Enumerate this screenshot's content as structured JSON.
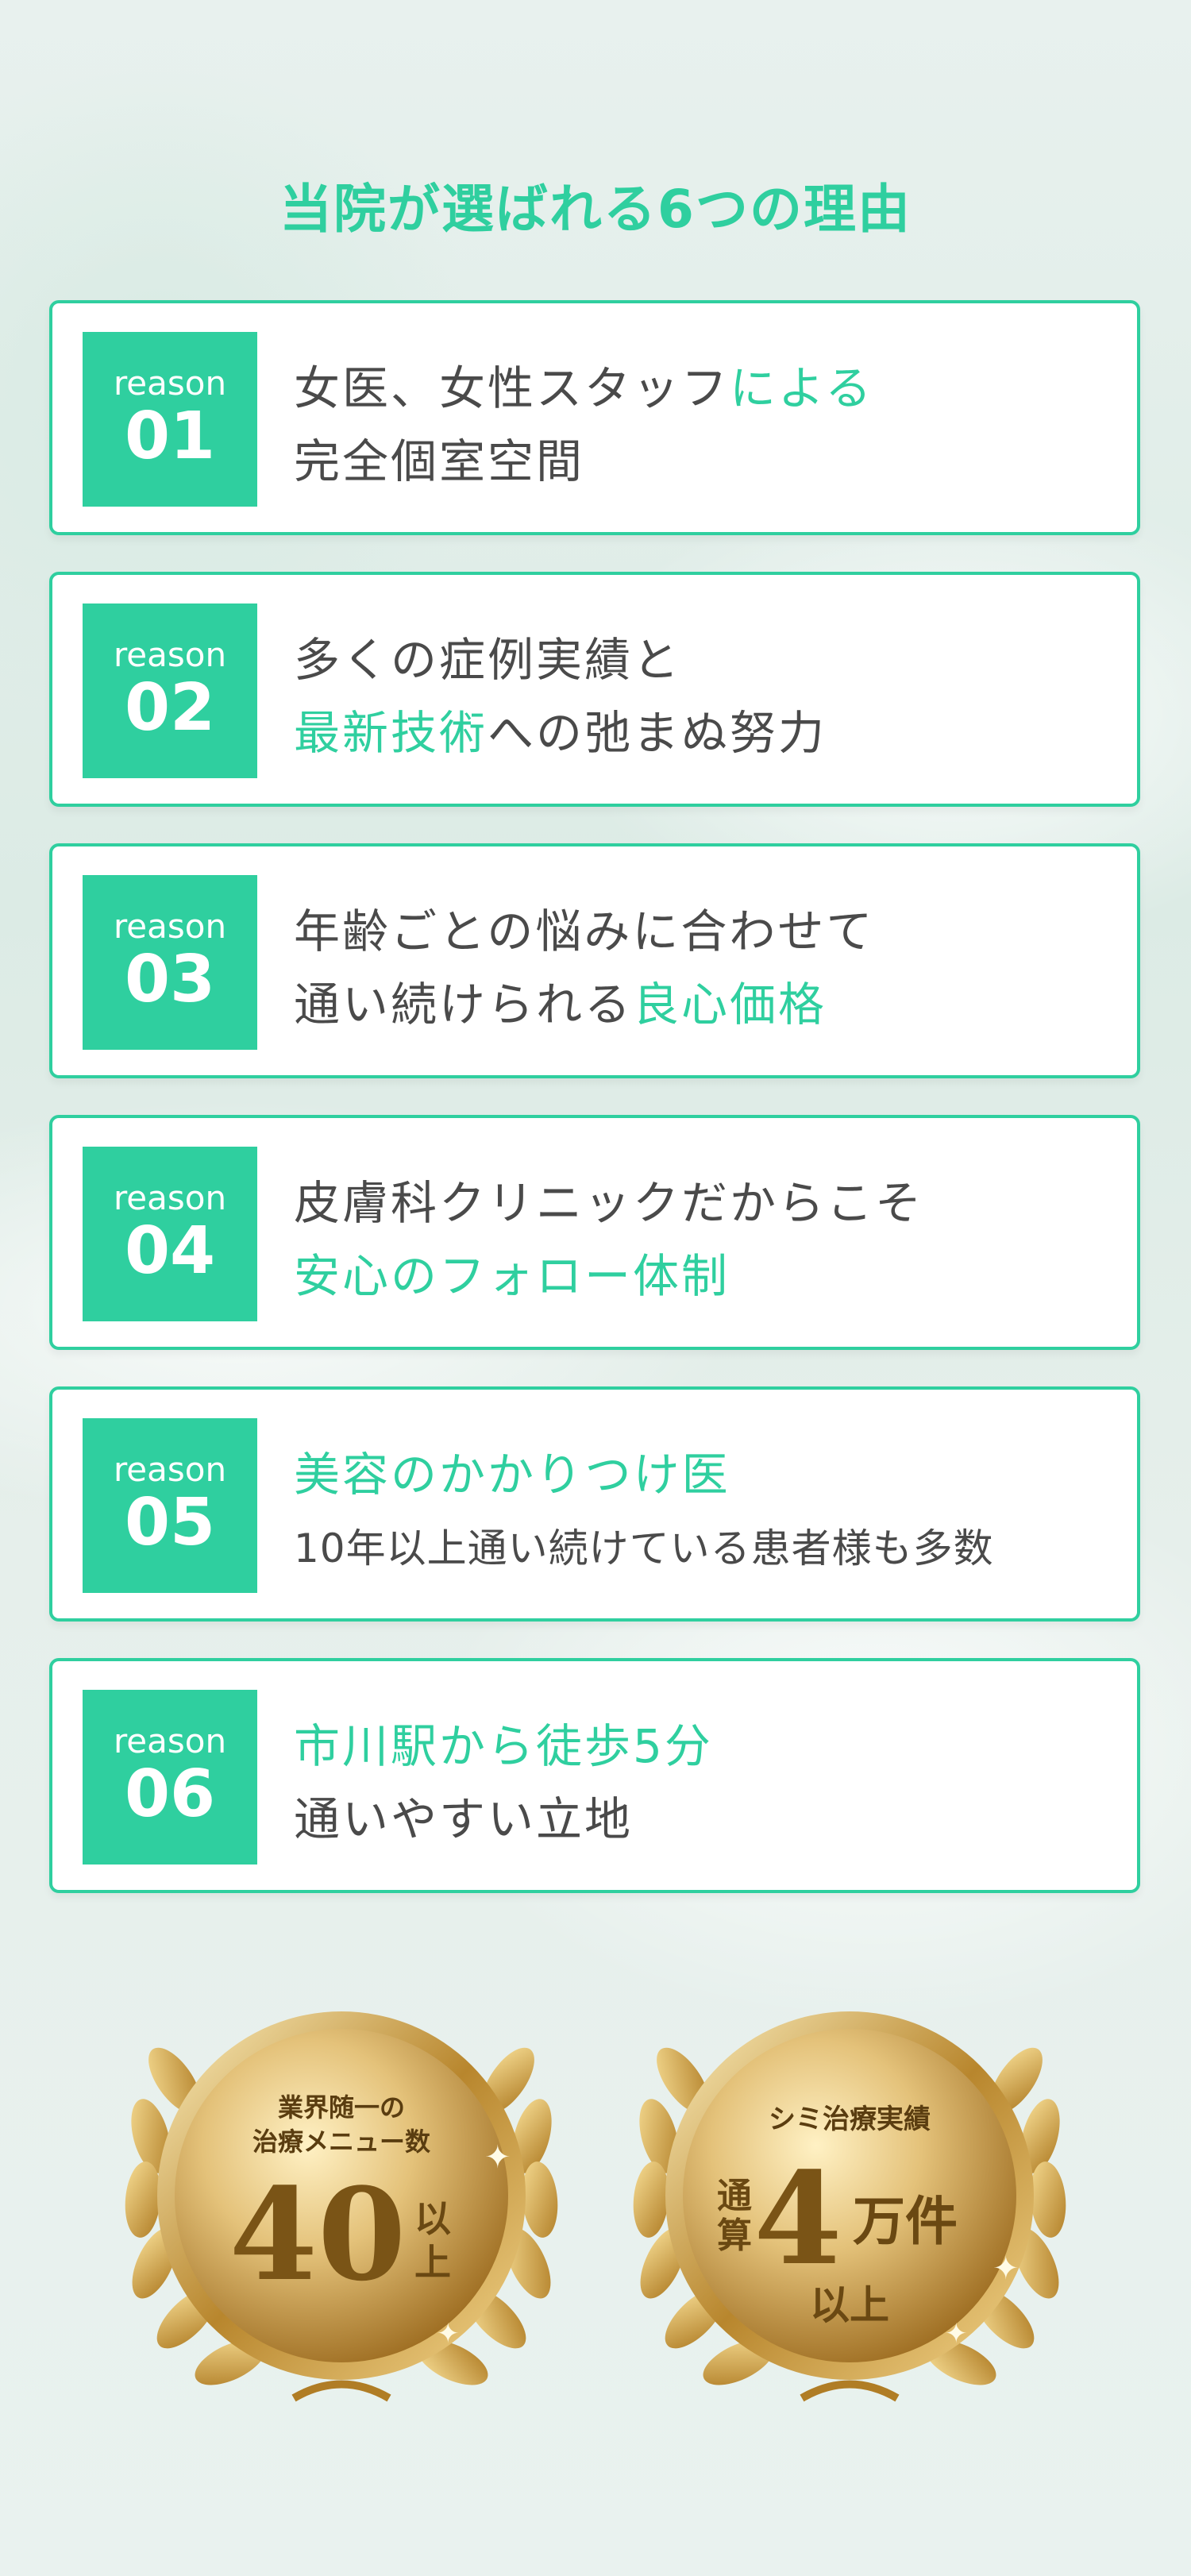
{
  "colors": {
    "accent": "#2fcf9f",
    "text": "#4a4a4a",
    "gold": "#c9952e"
  },
  "title": "当院が選ばれる6つの理由",
  "reasons": [
    {
      "badge_word": "reason",
      "badge_num": "01",
      "line1": [
        {
          "text": "女医、女性スタッフ"
        },
        {
          "text": "による",
          "accent": true
        }
      ],
      "line2": [
        {
          "text": "完全個室空間"
        }
      ]
    },
    {
      "badge_word": "reason",
      "badge_num": "02",
      "line1": [
        {
          "text": "多くの症例実績と"
        }
      ],
      "line2": [
        {
          "text": "最新技術",
          "accent": true
        },
        {
          "text": "への弛まぬ努力"
        }
      ]
    },
    {
      "badge_word": "reason",
      "badge_num": "03",
      "line1": [
        {
          "text": "年齢ごとの悩みに合わせて"
        }
      ],
      "line2": [
        {
          "text": "通い続けられる"
        },
        {
          "text": "良心価格",
          "accent": true
        }
      ]
    },
    {
      "badge_word": "reason",
      "badge_num": "04",
      "line1": [
        {
          "text": "皮膚科クリニックだからこそ"
        }
      ],
      "line2": [
        {
          "text": "安心のフォロー体制",
          "accent": true
        }
      ]
    },
    {
      "badge_word": "reason",
      "badge_num": "05",
      "line1": [
        {
          "text": "美容のかかりつけ医",
          "accent": true
        }
      ],
      "line2": [
        {
          "text": "10年以上通い続けている患者様も多数"
        }
      ]
    },
    {
      "badge_word": "reason",
      "badge_num": "06",
      "line1": [
        {
          "text": "市川駅から徒歩5分",
          "accent": true
        }
      ],
      "line2": [
        {
          "text": "通いやすい立地"
        }
      ]
    }
  ],
  "medals": [
    {
      "top1": "業界随一の",
      "top2": "治療メニュー数",
      "big": "40",
      "side1": "以",
      "side2": "上"
    },
    {
      "top1": "シミ治療実績",
      "left1": "通",
      "left2": "算",
      "big": "4",
      "unit": "万件",
      "bottom": "以上"
    }
  ]
}
